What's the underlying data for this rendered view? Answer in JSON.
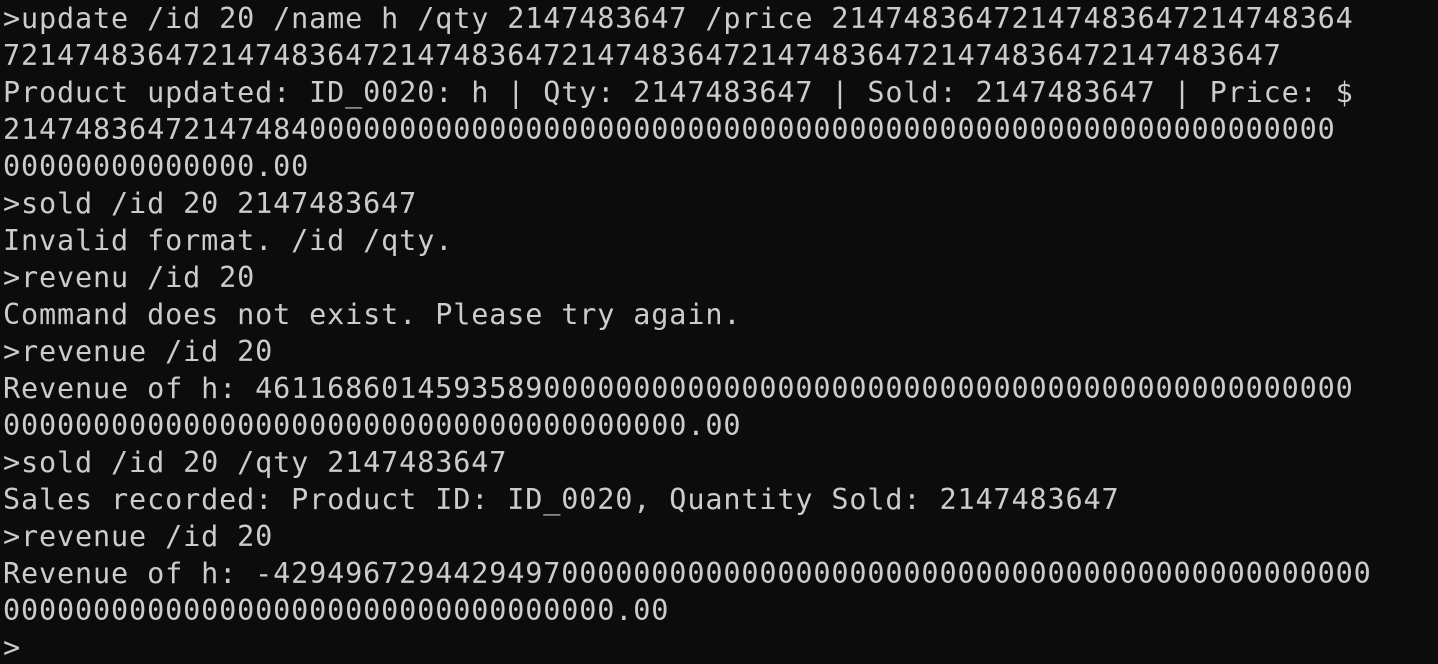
{
  "terminal": {
    "lines": [
      ">update /id 20 /name h /qty 2147483647 /price 21474836472147483647214748364",
      "72147483647214748364721474836472147483647214748364721474836472147483647",
      "Product updated: ID_0020: h | Qty: 2147483647 | Sold: 2147483647 | Price: $",
      "21474836472147484000000000000000000000000000000000000000000000000000000000",
      "00000000000000.00",
      ">sold /id 20 2147483647",
      "Invalid format. /id /qty.",
      ">revenu /id 20",
      "Command does not exist. Please try again.",
      ">revenue /id 20",
      "Revenue of h: 4611686014593589000000000000000000000000000000000000000000000",
      "00000000000000000000000000000000000000.00",
      ">sold /id 20 /qty 2147483647",
      "Sales recorded: Product ID: ID_0020, Quantity Sold: 2147483647",
      ">revenue /id 20",
      "Revenue of h: -4294967294429497000000000000000000000000000000000000000000000",
      "0000000000000000000000000000000000.00"
    ],
    "prompt": ">",
    "input_value": "",
    "colors": {
      "background": "#0c0c0c",
      "foreground": "#cccccc"
    }
  }
}
